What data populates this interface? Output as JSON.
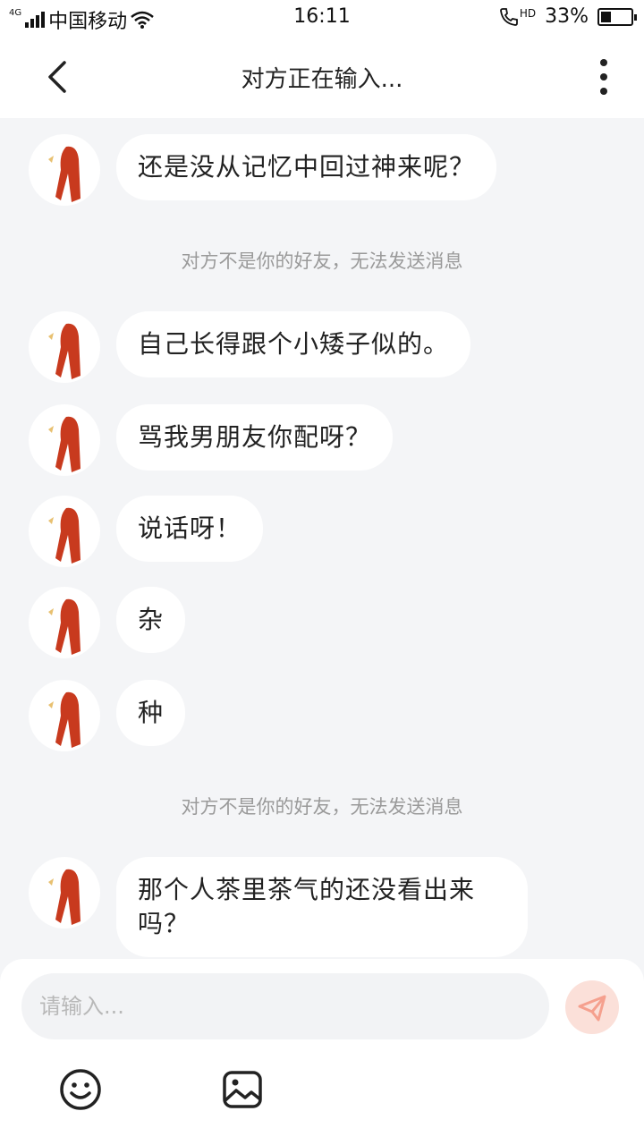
{
  "status_bar": {
    "network": "4G",
    "carrier": "中国移动",
    "time": "16:11",
    "hd": "HD",
    "battery_percent": "33%",
    "battery_level": 0.33
  },
  "header": {
    "title": "对方正在输入..."
  },
  "messages": [
    {
      "text": "还是没从记忆中回过神来呢？"
    },
    {
      "text": "自己长得跟个小矮子似的。"
    },
    {
      "text": "骂我男朋友你配呀？"
    },
    {
      "text": "说话呀！"
    },
    {
      "text": "杂"
    },
    {
      "text": "种"
    },
    {
      "text": "那个人茶里茶气的还没看出来吗？"
    }
  ],
  "system_notes": [
    "对方不是你的好友，无法发送消息",
    "对方不是你的好友，无法发送消息"
  ],
  "input": {
    "placeholder": "请输入..."
  },
  "colors": {
    "background": "#f4f5f7",
    "bubble": "#ffffff",
    "send_button": "#fbe0d9",
    "send_icon": "#f5a08e",
    "avatar_hair": "#c83a1e"
  },
  "icons": {
    "back": "chevron-left-icon",
    "more": "more-vertical-icon",
    "send": "paper-plane-icon",
    "emoji": "smiley-icon",
    "image": "image-icon"
  }
}
